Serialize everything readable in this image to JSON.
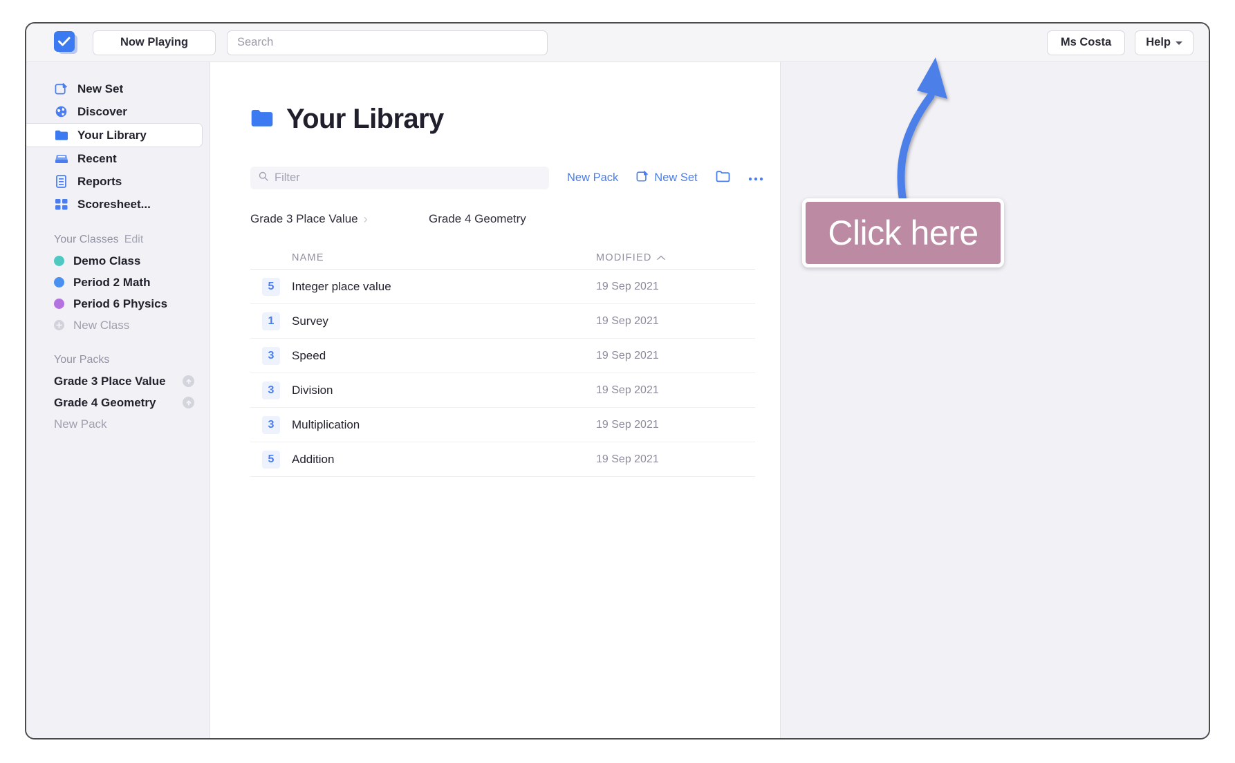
{
  "window": {
    "accent_blue": "#4a7df0",
    "sidebar_bg": "#f1f1f6",
    "callout_bg": "#bc8aa2"
  },
  "topbar": {
    "logo_icon": "checkbox-card-icon",
    "now_playing_label": "Now Playing",
    "search": {
      "value": "",
      "placeholder": "Search"
    },
    "user_label": "Ms Costa",
    "help_label": "Help",
    "help_chevron_icon": "chevron-down-icon"
  },
  "sidebar": {
    "nav": [
      {
        "label": "New Set",
        "icon": "compose-icon",
        "selected": false
      },
      {
        "label": "Discover",
        "icon": "globe-icon",
        "selected": false
      },
      {
        "label": "Your Library",
        "icon": "folder-icon",
        "selected": true
      },
      {
        "label": "Recent",
        "icon": "inbox-tray-icon",
        "selected": false
      },
      {
        "label": "Reports",
        "icon": "document-icon",
        "selected": false
      },
      {
        "label": "Scoresheet...",
        "icon": "grid-squares-icon",
        "selected": false
      }
    ],
    "classes_header": "Your Classes",
    "classes_edit_label": "Edit",
    "classes": [
      {
        "label": "Demo Class",
        "color": "#4ec8c0",
        "icon": "class-dot-icon"
      },
      {
        "label": "Period 2 Math",
        "color": "#4a90f0",
        "icon": "class-dot-icon"
      },
      {
        "label": "Period 6 Physics",
        "color": "#b472e0",
        "icon": "class-dot-icon"
      }
    ],
    "new_class_label": "New Class",
    "new_class_icon": "plus-circle-icon",
    "packs_header": "Your Packs",
    "packs": [
      {
        "label": "Grade 3 Place Value",
        "badge_icon": "arrow-up-circle-icon"
      },
      {
        "label": "Grade 4 Geometry",
        "badge_icon": "arrow-up-circle-icon"
      }
    ],
    "new_pack_label": "New Pack"
  },
  "main": {
    "title": "Your Library",
    "title_icon": "folder-icon",
    "filter": {
      "value": "",
      "placeholder": "Filter",
      "icon": "search-icon"
    },
    "actions": [
      {
        "label": "New Pack",
        "icon": ""
      },
      {
        "label": "New Set",
        "icon": "compose-icon"
      }
    ],
    "folder_button_icon": "folder-outline-icon",
    "more_button_icon": "ellipsis-icon",
    "breadcrumbs": [
      {
        "label": "Grade 3 Place Value",
        "chevron_icon": "chevron-right-icon"
      },
      {
        "label": "Grade 4 Geometry",
        "chevron_icon": "chevron-right-icon"
      }
    ],
    "table": {
      "columns": [
        {
          "key": "name",
          "label": "NAME"
        },
        {
          "key": "modified",
          "label": "MODIFIED",
          "sort_icon": "chevron-up-icon"
        }
      ],
      "rows": [
        {
          "count": "5",
          "name": "Integer place value",
          "modified": "19 Sep 2021"
        },
        {
          "count": "1",
          "name": "Survey",
          "modified": "19 Sep 2021"
        },
        {
          "count": "3",
          "name": "Speed",
          "modified": "19 Sep 2021"
        },
        {
          "count": "3",
          "name": "Division",
          "modified": "19 Sep 2021"
        },
        {
          "count": "3",
          "name": "Multiplication",
          "modified": "19 Sep 2021"
        },
        {
          "count": "5",
          "name": "Addition",
          "modified": "19 Sep 2021"
        }
      ]
    }
  },
  "annotation": {
    "callout_text": "Click here",
    "arrow_icon": "curved-arrow-icon"
  }
}
